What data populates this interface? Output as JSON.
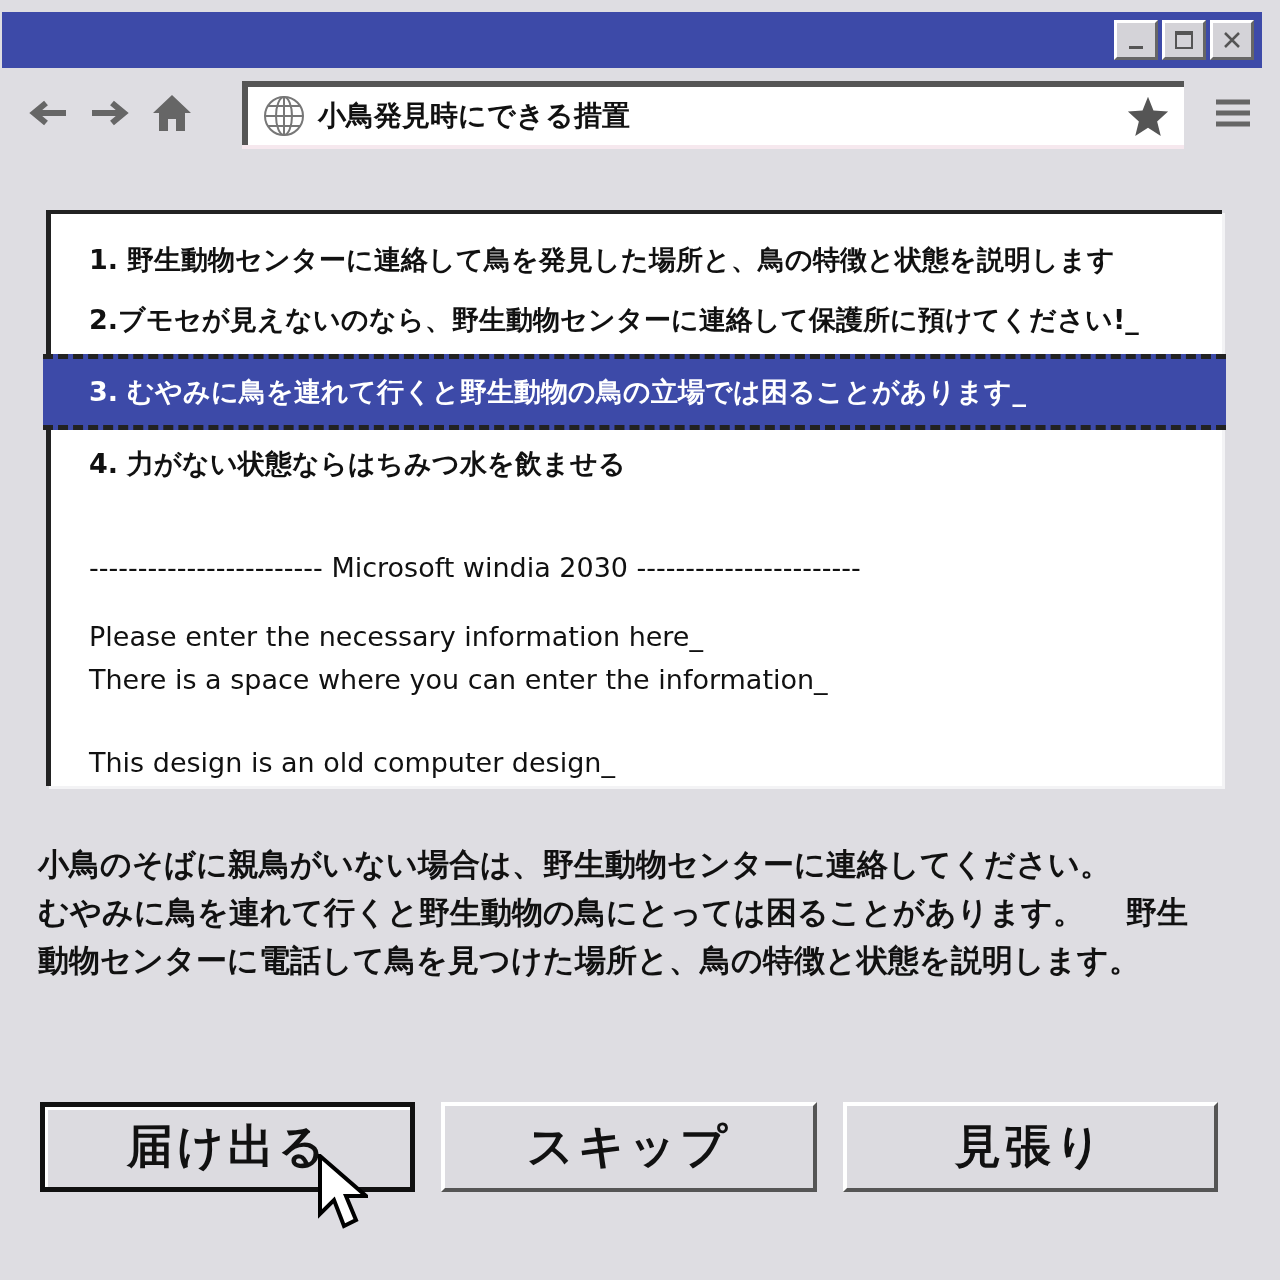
{
  "address_bar": {
    "value": "小鳥発見時にできる措置"
  },
  "list": {
    "items": [
      {
        "text": "1. 野生動物センターに連絡して鳥を発見した場所と、鳥の特徴と状態を説明します",
        "selected": false
      },
      {
        "text": "2.ブモセが見えないのなら、野生動物センターに連絡して保護所に預けてください!_",
        "selected": false
      },
      {
        "text": "3. むやみに鳥を連れて行くと野生動物の鳥の立場では困ることがあります_",
        "selected": true
      },
      {
        "text": "4. 力がない状態ならはちみつ水を飲ませる",
        "selected": false
      }
    ],
    "divider_text": "------------------------ Microsoft windia 2030 -----------------------",
    "paragraphs": [
      [
        "Please enter the necessary information here_",
        "There is a space where you can enter the information_"
      ],
      [
        "This design is an old computer design_"
      ]
    ]
  },
  "message": [
    "小鳥のそばに親鳥がいない場合は、野生動物センターに連絡してください。",
    "むやみに鳥を連れて行くと野生動物の鳥にとっては困ることがあります。　 野生動物センターに電話して鳥を見つけた場所と、鳥の特徴と状態を説明します。"
  ],
  "buttons": [
    {
      "label": "届け出る",
      "selected": true
    },
    {
      "label": "スキップ",
      "selected": false
    },
    {
      "label": "見張り",
      "selected": false
    }
  ]
}
